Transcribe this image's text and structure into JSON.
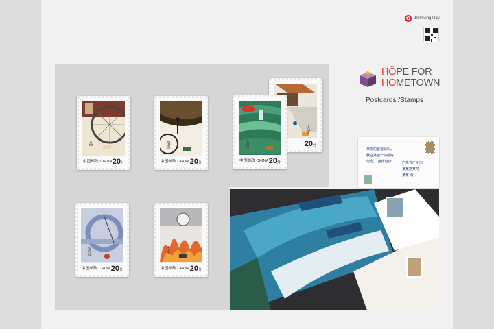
{
  "brand": {
    "giving_day": "99 Giving Day",
    "title_line1_red": "H",
    "title_line1_o": "Ö",
    "title_line1_rest": "PE FOR",
    "title_line2_red": "HO",
    "title_line2_rest": "METOWN",
    "subtitle": "Postcards /Stamps"
  },
  "stamps": [
    {
      "country": "中国邮政 CHINA",
      "value": "20",
      "unit": "分",
      "name": "大学"
    },
    {
      "country": "中国邮政 CHINA",
      "value": "20",
      "unit": "分",
      "name": "福建"
    },
    {
      "country": "中国邮政 CHINA",
      "value": "20",
      "unit": "分",
      "name": "山西"
    },
    {
      "country": "",
      "value": "20",
      "unit": "分",
      "name": "大学"
    },
    {
      "country": "中国邮政 CHINA",
      "value": "20",
      "unit": "分",
      "name": "浙江"
    },
    {
      "country": "中国邮政 CHINA",
      "value": "20",
      "unit": "分",
      "name": "大水"
    }
  ],
  "postcard": {
    "line1": "亲爱的爸爸妈妈，",
    "line2": "我在外面一切都好",
    "line3": "勿念。 身体健康",
    "address": "广东省广州市",
    "addr2": "某某路某号",
    "addr3": "某某 收"
  },
  "colors": {
    "accent": "#e23a2e",
    "board": "#d6d6d6"
  }
}
